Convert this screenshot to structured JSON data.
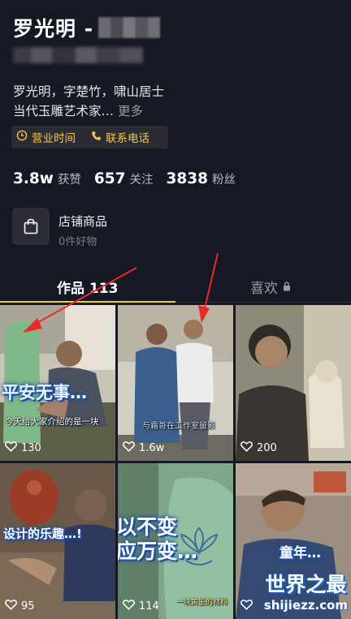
{
  "profile": {
    "name": "罗光明 -",
    "bio_line1": "罗光明，字楚竹，啸山居士",
    "bio_line2": "当代玉雕艺术家…",
    "more_label": "更多"
  },
  "tags": {
    "hours": "营业时间",
    "phone": "联系电话",
    "color": "#f3c84b"
  },
  "stats": [
    {
      "value": "3.8w",
      "label": "获赞"
    },
    {
      "value": "657",
      "label": "关注"
    },
    {
      "value": "3838",
      "label": "粉丝"
    }
  ],
  "shop": {
    "title": "店铺商品",
    "subtitle": "0件好物"
  },
  "tabs": {
    "works": "作品 113",
    "likes": "喜欢"
  },
  "videos": [
    {
      "likes": "130",
      "caption_big": "平安无事…",
      "caption_small": "今天给大家介绍的是一块"
    },
    {
      "likes": "1.6w",
      "caption_big": "",
      "caption_small": "与霜哥在工作室留影"
    },
    {
      "likes": "200",
      "caption_big": "",
      "caption_small": ""
    },
    {
      "likes": "95",
      "caption_big": "设计的乐趣…!",
      "caption_small": ""
    },
    {
      "likes": "114",
      "caption_big": "以不变\n应万变…",
      "caption_small": "一块黄玉的材料"
    },
    {
      "likes": "",
      "caption_big": "童年…",
      "caption_small": ""
    }
  ],
  "watermark": {
    "title": "世界之最",
    "url": "shijiezz.com"
  }
}
